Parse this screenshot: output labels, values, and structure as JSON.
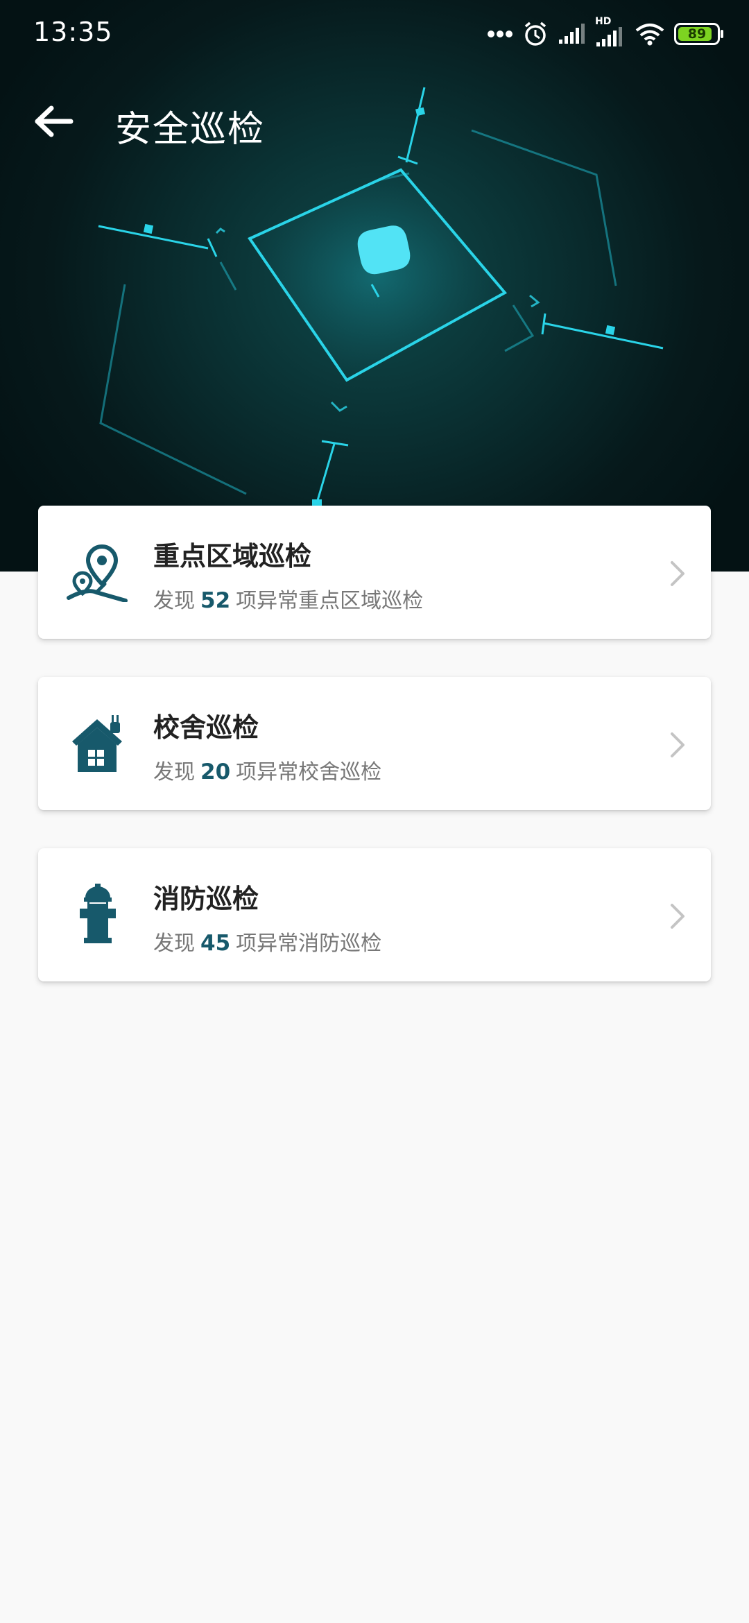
{
  "status_bar": {
    "time": "13:35",
    "battery_level": "89",
    "network_label": "HD",
    "colors": {
      "battery_fill": "#7dd321"
    }
  },
  "header": {
    "title": "安全巡检",
    "back_icon": "arrow-left-icon"
  },
  "theme": {
    "primary": "#17596b",
    "hero_glow": "#2ad4e8",
    "background": "#f9f9f9"
  },
  "inspections": [
    {
      "icon": "map-pin-route-icon",
      "title": "重点区域巡检",
      "prefix": "发现",
      "count": "52",
      "suffix": "项异常重点区域巡检"
    },
    {
      "icon": "house-plug-icon",
      "title": "校舍巡检",
      "prefix": "发现",
      "count": "20",
      "suffix": "项异常校舍巡检"
    },
    {
      "icon": "fire-hydrant-icon",
      "title": "消防巡检",
      "prefix": "发现",
      "count": "45",
      "suffix": "项异常消防巡检"
    }
  ]
}
